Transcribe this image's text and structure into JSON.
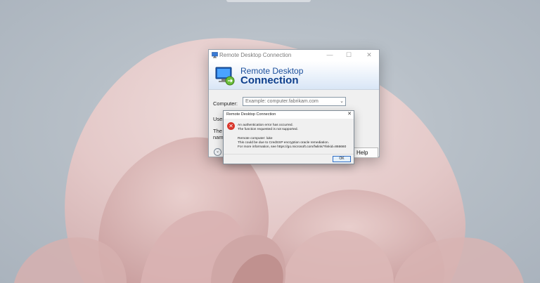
{
  "main_window": {
    "title": "Remote Desktop Connection",
    "controls": {
      "minimize": "—",
      "maximize": "☐",
      "close": "✕"
    },
    "banner": {
      "line1": "Remote Desktop",
      "line2": "Connection"
    },
    "computer_label": "Computer:",
    "computer_placeholder": "Example: computer.fabrikam.com",
    "user_label": "User",
    "desc_line1": "The c",
    "desc_line2": "name",
    "options_glyph": "⌄",
    "help_label": "Help"
  },
  "error_dialog": {
    "title": "Remote Desktop Connection",
    "close": "✕",
    "icon": "error-icon",
    "icon_glyph": "✕",
    "lines": [
      "An authentication error has occurred.",
      "The function requested is not supported.",
      "",
      "Remote computer: luke",
      "This could be due to CredSSP encryption oracle remediation.",
      "For more information, see https://go.microsoft.com/fwlink/?linkid=866660"
    ],
    "ok_label": "OK"
  },
  "colors": {
    "accent": "#1b4f9c",
    "error": "#d9362b",
    "wallpaper_petal": "#e8cfcf"
  }
}
